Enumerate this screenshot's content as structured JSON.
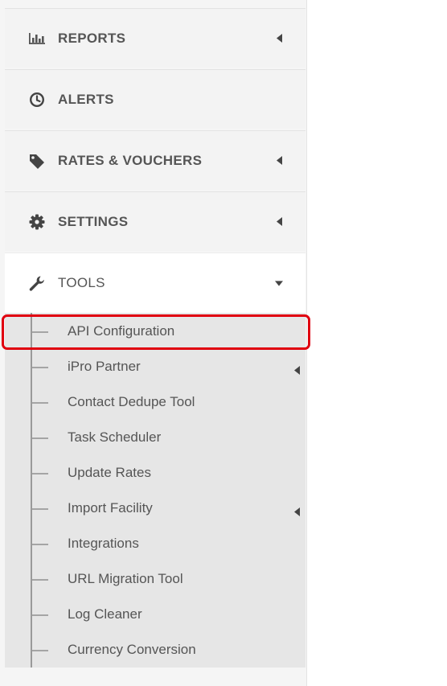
{
  "sidebar": {
    "items": [
      {
        "label": "REPORTS",
        "icon": "bar-chart-icon",
        "expandable": true
      },
      {
        "label": "ALERTS",
        "icon": "clock-icon",
        "expandable": false
      },
      {
        "label": "RATES & VOUCHERS",
        "icon": "tag-icon",
        "expandable": true
      },
      {
        "label": "SETTINGS",
        "icon": "gear-icon",
        "expandable": true
      },
      {
        "label": "TOOLS",
        "icon": "wrench-icon",
        "expanded": true
      }
    ],
    "tools_submenu": [
      {
        "label": "API Configuration",
        "highlighted": true
      },
      {
        "label": "iPro Partner",
        "has_submenu": true
      },
      {
        "label": "Contact Dedupe Tool"
      },
      {
        "label": "Task Scheduler"
      },
      {
        "label": "Update Rates"
      },
      {
        "label": "Import Facility",
        "has_submenu": true
      },
      {
        "label": "Integrations"
      },
      {
        "label": "URL Migration Tool"
      },
      {
        "label": "Log Cleaner"
      },
      {
        "label": "Currency Conversion"
      }
    ]
  },
  "colors": {
    "highlight_border": "#e00010",
    "text": "#555555",
    "submenu_bg": "#e6e6e6"
  }
}
